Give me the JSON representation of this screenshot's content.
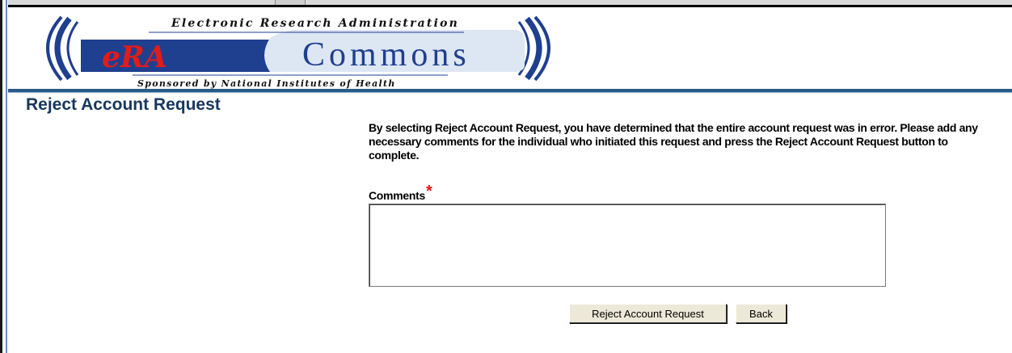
{
  "header": {
    "logo_top_text": "Electronic Research Administration",
    "logo_era": "eRA",
    "logo_commons": "Commons",
    "logo_bottom_text": "Sponsored by National Institutes of Health"
  },
  "page": {
    "title": "Reject Account Request",
    "instructions": "By selecting Reject Account Request, you have determined that the entire account request was in error. Please add any necessary comments for the individual who initiated this request and press the Reject Account Request button to complete."
  },
  "form": {
    "comments_label": "Comments",
    "required_marker": "*",
    "comments_value": "",
    "reject_button_label": "Reject Account Request",
    "back_button_label": "Back"
  },
  "colors": {
    "title": "#17375e",
    "header_rule": "#2a5a86",
    "logo_blue": "#1f3f8f",
    "logo_light": "#dde6f3",
    "required": "#e11111"
  }
}
